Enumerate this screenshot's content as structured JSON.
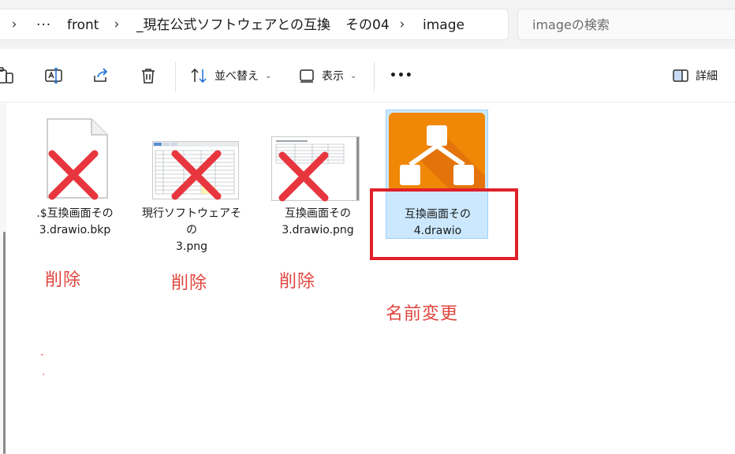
{
  "address_bar": {
    "breadcrumb": [
      "front",
      "_現在公式ソフトウェアとの互換",
      "その04",
      "image"
    ],
    "overflow_label": "···",
    "search_placeholder": "imageの検索"
  },
  "command_bar": {
    "sort_label": "並べ替え",
    "view_label": "表示",
    "more_label": "•••",
    "details_label": "詳細"
  },
  "files": [
    {
      "name_line1": ".$互換画面その",
      "name_line2": "3.drawio.bkp",
      "kind": "generic-file",
      "marked_delete": true
    },
    {
      "name_line1": "現行ソフトウェアその",
      "name_line2": "3.png",
      "kind": "spreadsheet-image",
      "marked_delete": true
    },
    {
      "name_line1": "互換画面その",
      "name_line2": "3.drawio.png",
      "kind": "document-image",
      "marked_delete": true
    },
    {
      "name_line1": "互換画面その",
      "name_line2": "4.drawio",
      "kind": "drawio",
      "marked_delete": false,
      "selected": true
    }
  ],
  "annotations": {
    "delete_1": "削除",
    "delete_2": "削除",
    "delete_3": "削除",
    "rename": "名前変更"
  },
  "colors": {
    "annotation_red": "#e0453e",
    "highlight_box": "#e0202a",
    "drawio_orange": "#f08705",
    "selection": "#cce8ff"
  }
}
